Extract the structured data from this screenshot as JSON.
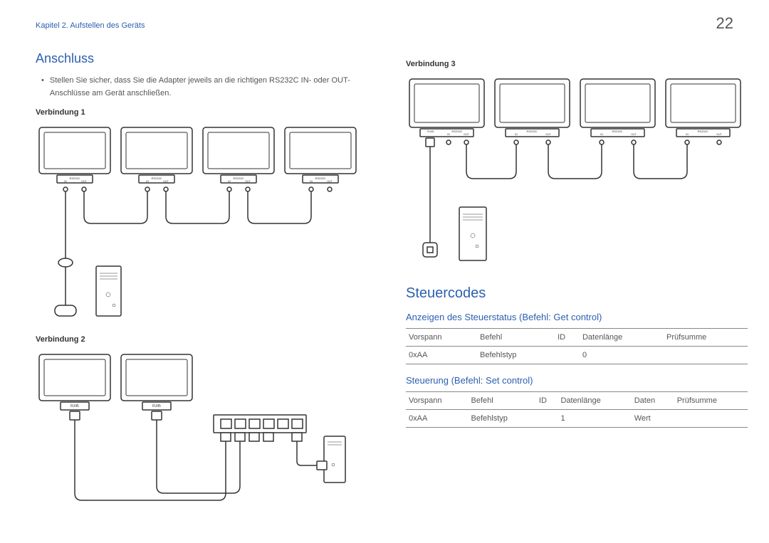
{
  "header": {
    "chapter": "Kapitel 2. Aufstellen des Geräts",
    "page": "22"
  },
  "left": {
    "title": "Anschluss",
    "bullet": "Stellen Sie sicher, dass Sie die Adapter jeweils an die richtigen RS232C IN- oder OUT-Anschlüsse am Gerät anschließen.",
    "conn1": "Verbindung 1",
    "conn2": "Verbindung 2",
    "portLabelRS": "RS232C",
    "portIn": "IN",
    "portOut": "OUT",
    "portRJ": "RJ45"
  },
  "right": {
    "conn3": "Verbindung 3",
    "title": "Steuercodes",
    "sub1": "Anzeigen des Steuerstatus (Befehl: Get control)",
    "sub2": "Steuerung (Befehl: Set control)",
    "table1": {
      "headers": [
        "Vorspann",
        "Befehl",
        "ID",
        "Datenlänge",
        "Prüfsumme"
      ],
      "row": [
        "0xAA",
        "Befehlstyp",
        "",
        "0",
        ""
      ]
    },
    "table2": {
      "headers": [
        "Vorspann",
        "Befehl",
        "ID",
        "Datenlänge",
        "Daten",
        "Prüfsumme"
      ],
      "row": [
        "0xAA",
        "Befehlstyp",
        "",
        "1",
        "Wert",
        ""
      ]
    }
  }
}
